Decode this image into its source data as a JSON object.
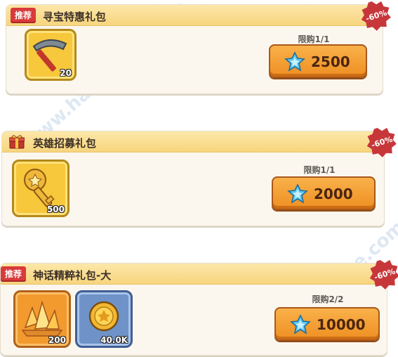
{
  "packs": [
    {
      "badge": "推荐",
      "title": "寻宝特惠礼包",
      "discount": "-60%",
      "limit": "限购1/1",
      "price": "2500",
      "items": [
        {
          "icon": "pickaxe-icon",
          "qty": "20",
          "frame": "yellow"
        }
      ]
    },
    {
      "badge": "",
      "title": "英雄招募礼包",
      "discount": "-60%",
      "limit": "限购1/1",
      "price": "2000",
      "items": [
        {
          "icon": "key-icon",
          "qty": "500",
          "frame": "yellow"
        }
      ]
    },
    {
      "badge": "推荐",
      "title": "神话精粹礼包-大",
      "discount": "-60%",
      "limit": "限购2/2",
      "price": "10000",
      "items": [
        {
          "icon": "crystal-icon",
          "qty": "200",
          "frame": "orange"
        },
        {
          "icon": "gold-coin-icon",
          "qty": "40.0K",
          "frame": "blue"
        }
      ]
    }
  ],
  "currency_icon": "blue-diamond-icon",
  "watermark": "www.hackhome.com",
  "colors": {
    "badge": "#d93a3a",
    "header": "#f7d57e",
    "button": "#ee8f22",
    "discount": "#c7373a"
  }
}
